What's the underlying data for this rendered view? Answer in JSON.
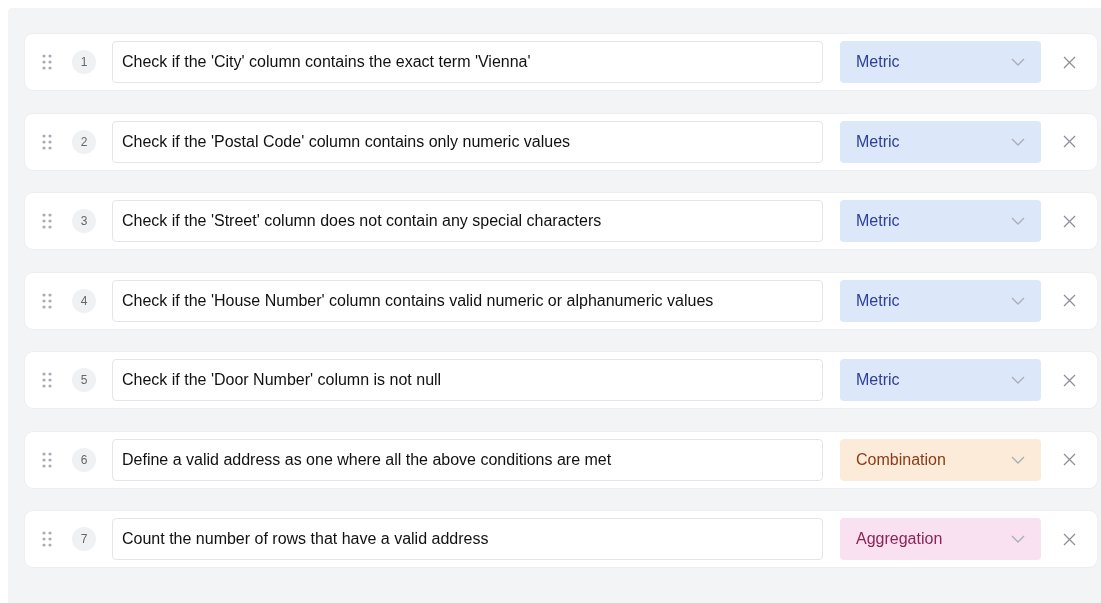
{
  "steps": [
    {
      "number": "1",
      "text": "Check if the 'City' column contains the exact term 'Vienna'",
      "type": {
        "kind": "metric",
        "label": "Metric"
      }
    },
    {
      "number": "2",
      "text": "Check if the 'Postal Code' column contains only numeric values",
      "type": {
        "kind": "metric",
        "label": "Metric"
      }
    },
    {
      "number": "3",
      "text": "Check if the 'Street' column does not contain any special characters",
      "type": {
        "kind": "metric",
        "label": "Metric"
      }
    },
    {
      "number": "4",
      "text": "Check if the 'House Number' column contains valid numeric or alphanumeric values",
      "type": {
        "kind": "metric",
        "label": "Metric"
      }
    },
    {
      "number": "5",
      "text": "Check if the 'Door Number' column is not null",
      "type": {
        "kind": "metric",
        "label": "Metric"
      }
    },
    {
      "number": "6",
      "text": "Define a valid address as one where all the above conditions are met",
      "type": {
        "kind": "combination",
        "label": "Combination"
      }
    },
    {
      "number": "7",
      "text": "Count the number of rows that have a valid address",
      "type": {
        "kind": "aggregation",
        "label": "Aggregation"
      }
    }
  ]
}
